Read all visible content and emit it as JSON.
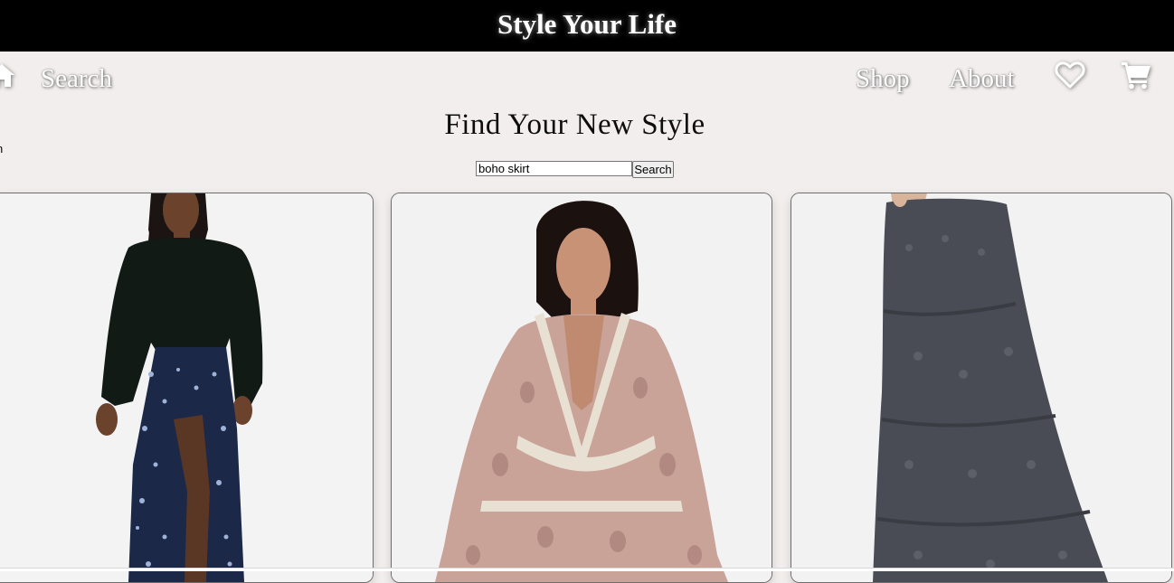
{
  "header": {
    "site_title": "Style Your Life"
  },
  "nav": {
    "home_icon": "home-icon",
    "search_label": "Search",
    "shop_label": "Shop",
    "about_label": "About",
    "favorites_icon": "heart-icon",
    "cart_icon": "cart-icon"
  },
  "main": {
    "heading": "Find Your New Style",
    "stray_text": "n",
    "search": {
      "value": "boho skirt",
      "button_label": "Search"
    },
    "products": [
      {
        "image": "model in dark green sweater and blue floral maxi skirt with side slit"
      },
      {
        "image": "model in pink paisley boho dress with lace v-neck trim"
      },
      {
        "image": "dark grey lace tiered maxi skirt"
      }
    ]
  },
  "colors": {
    "header_bg": "#000000",
    "page_bg": "#f2eeee",
    "nav_text": "#ffffff"
  }
}
